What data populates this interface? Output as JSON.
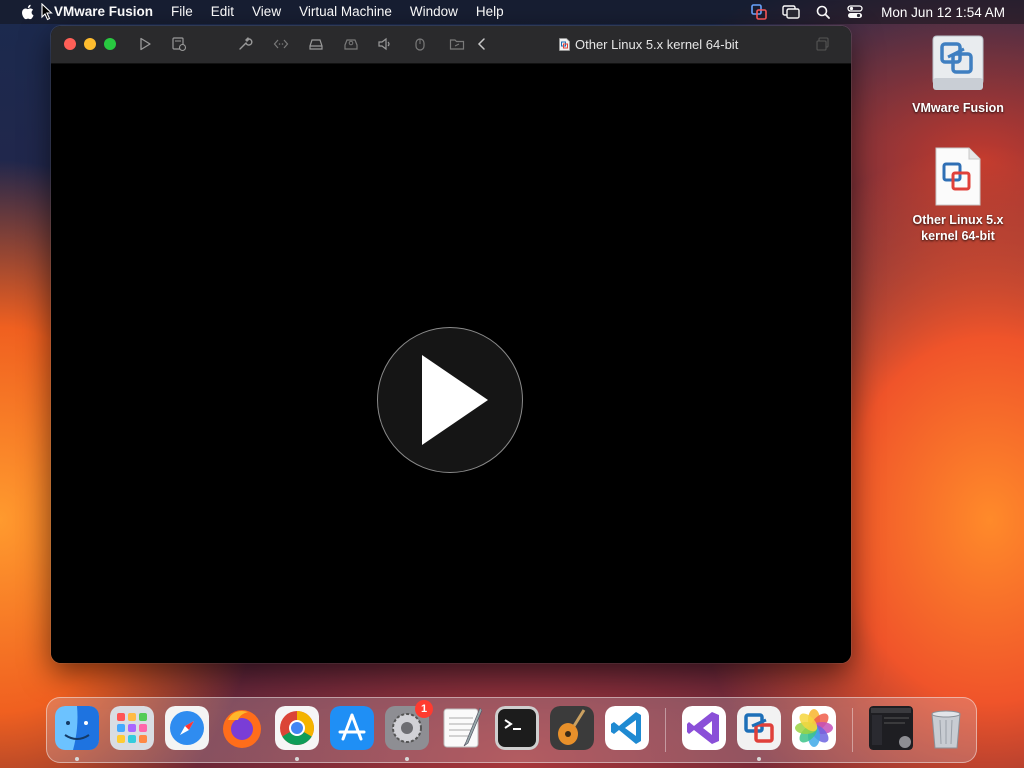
{
  "menubar": {
    "app_name": "VMware Fusion",
    "items": [
      "File",
      "Edit",
      "View",
      "Virtual Machine",
      "Window",
      "Help"
    ],
    "clock": "Mon Jun 12  1:54 AM"
  },
  "window": {
    "title": "Other Linux 5.x kernel 64-bit",
    "toolbar": [
      "play-icon",
      "snapshot-icon",
      "wrench-icon",
      "code-icon",
      "drive-icon",
      "printer-icon",
      "sound-icon",
      "usb-icon",
      "shared-folder-icon",
      "back-icon"
    ]
  },
  "desktop": {
    "icons": [
      {
        "label": "VMware Fusion"
      },
      {
        "label": "Other Linux 5.x kernel 64-bit"
      }
    ]
  },
  "dock": {
    "apps": [
      "Finder",
      "Launchpad",
      "Safari",
      "Firefox",
      "Chrome",
      "App Store",
      "System Settings",
      "TextEdit",
      "Terminal",
      "GarageBand",
      "Visual Studio Code",
      "Visual Studio",
      "VMware Fusion",
      "Photos"
    ],
    "settings_badge": "1"
  },
  "colors": {
    "red": "#ff5f57",
    "yellow": "#febc2e",
    "green": "#28c840",
    "vmware_blue": "#1d6fb8"
  }
}
